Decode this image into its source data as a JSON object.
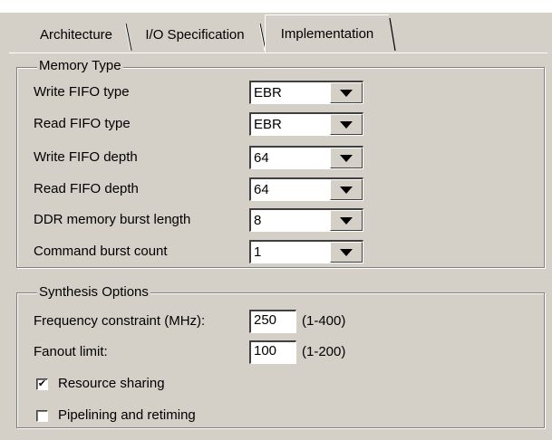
{
  "tabs": [
    {
      "label": "Architecture"
    },
    {
      "label": "I/O Specification"
    },
    {
      "label": "Implementation",
      "active": true
    }
  ],
  "memory_type": {
    "title": "Memory Type",
    "rows": [
      {
        "label": "Write FIFO type",
        "value": "EBR"
      },
      {
        "label": "Read FIFO type",
        "value": "EBR"
      },
      {
        "label": "Write FIFO depth",
        "value": "64"
      },
      {
        "label": "Read FIFO depth",
        "value": "64"
      },
      {
        "label": "DDR memory burst length",
        "value": "8"
      },
      {
        "label": "Command burst count",
        "value": "1"
      }
    ]
  },
  "synthesis": {
    "title": "Synthesis Options",
    "frequency": {
      "label": "Frequency constraint (MHz):",
      "value": "250",
      "range": "(1-400)"
    },
    "fanout": {
      "label": "Fanout limit:",
      "value": "100",
      "range": "(1-200)"
    },
    "resource_sharing": {
      "label": "Resource sharing",
      "checked": true,
      "mark": "✔"
    },
    "pipelining": {
      "label": "Pipelining and retiming",
      "checked": false,
      "mark": ""
    }
  }
}
